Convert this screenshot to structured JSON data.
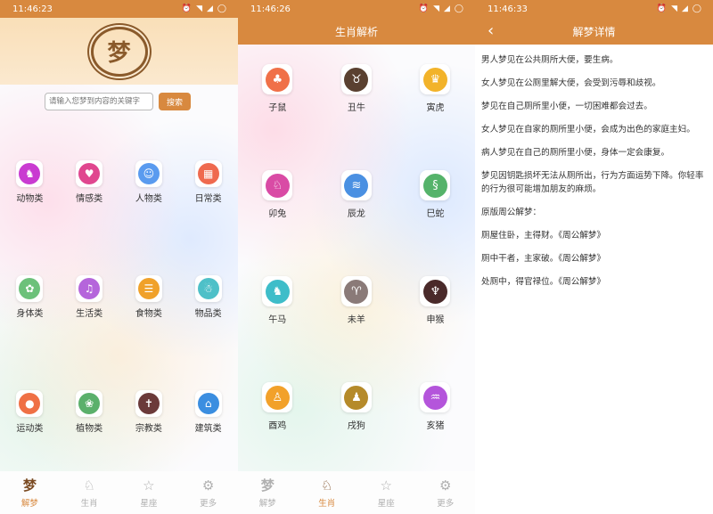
{
  "colors": {
    "accent": "#d8893f",
    "brown": "#8a5a2b"
  },
  "screen1": {
    "status_time": "11:46:23",
    "logo_char": "梦",
    "search": {
      "placeholder": "请输入您梦到内容的关键字",
      "button": "搜索"
    },
    "categories": [
      {
        "label": "动物类",
        "icon": "animal-icon",
        "glyph": "♞",
        "color": "#c93bd1"
      },
      {
        "label": "情感类",
        "icon": "heart-icon",
        "glyph": "♥",
        "color": "#e0478f"
      },
      {
        "label": "人物类",
        "icon": "people-icon",
        "glyph": "☺",
        "color": "#5a9bef"
      },
      {
        "label": "日常类",
        "icon": "calendar-icon",
        "glyph": "▦",
        "color": "#ef6a4f"
      },
      {
        "label": "身体类",
        "icon": "body-icon",
        "glyph": "✿",
        "color": "#6cc17a"
      },
      {
        "label": "生活类",
        "icon": "music-icon",
        "glyph": "♫",
        "color": "#b565db"
      },
      {
        "label": "食物类",
        "icon": "food-icon",
        "glyph": "☰",
        "color": "#f0a12a"
      },
      {
        "label": "物品类",
        "icon": "item-icon",
        "glyph": "☃",
        "color": "#4ec0c8"
      },
      {
        "label": "运动类",
        "icon": "ball-icon",
        "glyph": "●",
        "color": "#ef7045"
      },
      {
        "label": "植物类",
        "icon": "plant-icon",
        "glyph": "❀",
        "color": "#5bb06b"
      },
      {
        "label": "宗教类",
        "icon": "cross-icon",
        "glyph": "✝",
        "color": "#6b3a3a"
      },
      {
        "label": "建筑类",
        "icon": "building-icon",
        "glyph": "⌂",
        "color": "#3b8ee0"
      }
    ],
    "tabs": [
      {
        "label": "解梦",
        "icon": "dream-icon",
        "glyph": "梦",
        "active": true
      },
      {
        "label": "生肖",
        "icon": "rabbit-icon",
        "glyph": "♘",
        "active": false
      },
      {
        "label": "星座",
        "icon": "star-icon",
        "glyph": "☆",
        "active": false
      },
      {
        "label": "更多",
        "icon": "gear-icon",
        "glyph": "⚙",
        "active": false
      }
    ]
  },
  "screen2": {
    "status_time": "11:46:26",
    "title": "生肖解析",
    "zodiacs": [
      {
        "label": "子鼠",
        "icon": "rat-icon",
        "glyph": "♣",
        "color": "#f07048"
      },
      {
        "label": "丑牛",
        "icon": "ox-icon",
        "glyph": "♉",
        "color": "#5a4030"
      },
      {
        "label": "寅虎",
        "icon": "tiger-icon",
        "glyph": "♛",
        "color": "#f2b32a"
      },
      {
        "label": "卯兔",
        "icon": "rabbit-icon",
        "glyph": "♘",
        "color": "#d94ba5"
      },
      {
        "label": "辰龙",
        "icon": "dragon-icon",
        "glyph": "≋",
        "color": "#4a90e2"
      },
      {
        "label": "巳蛇",
        "icon": "snake-icon",
        "glyph": "§",
        "color": "#55b36a"
      },
      {
        "label": "午马",
        "icon": "horse-icon",
        "glyph": "♞",
        "color": "#3ebdc9"
      },
      {
        "label": "未羊",
        "icon": "sheep-icon",
        "glyph": "♈",
        "color": "#8a7a78"
      },
      {
        "label": "申猴",
        "icon": "monkey-icon",
        "glyph": "♆",
        "color": "#4a2a2a"
      },
      {
        "label": "酉鸡",
        "icon": "rooster-icon",
        "glyph": "♙",
        "color": "#f2a12a"
      },
      {
        "label": "戌狗",
        "icon": "dog-icon",
        "glyph": "♟",
        "color": "#b58a2a"
      },
      {
        "label": "亥猪",
        "icon": "pig-icon",
        "glyph": "♒",
        "color": "#b455db"
      }
    ],
    "tabs": [
      {
        "label": "解梦",
        "icon": "dream-icon",
        "glyph": "梦",
        "active": false
      },
      {
        "label": "生肖",
        "icon": "rabbit-icon",
        "glyph": "♘",
        "active": true
      },
      {
        "label": "星座",
        "icon": "star-icon",
        "glyph": "☆",
        "active": false
      },
      {
        "label": "更多",
        "icon": "gear-icon",
        "glyph": "⚙",
        "active": false
      }
    ]
  },
  "screen3": {
    "status_time": "11:46:33",
    "title": "解梦详情",
    "paragraphs": [
      "男人梦见在公共厕所大便，要生病。",
      "女人梦见在公厕里解大便，会受到污辱和歧视。",
      "梦见在自己厕所里小便，一切困难都会过去。",
      "女人梦见在自家的厕所里小便，会成为出色的家庭主妇。",
      "病人梦见在自己的厕所里小便，身体一定会康复。",
      "梦见因钥匙损坏无法从厕所出，行为方面运势下降。你轻率的行为很可能增加朋友的麻烦。",
      "原版周公解梦：",
      "厕屋住卧，主得财。《周公解梦》",
      "厕中干者，主家破。《周公解梦》",
      "处厕中，得官禄位。《周公解梦》"
    ]
  }
}
